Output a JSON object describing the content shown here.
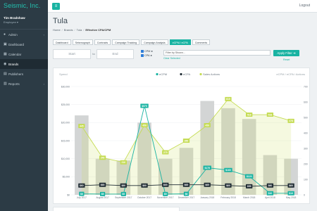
{
  "sidebar": {
    "brand": "Seismic, Inc.",
    "user_name": "Tim Bradshaw",
    "user_role": "Employee",
    "items": [
      {
        "label": "Admin",
        "icon": "user-icon",
        "caret": "‹"
      },
      {
        "label": "Dashboard",
        "icon": "dashboard-icon",
        "caret": ""
      },
      {
        "label": "Calendar",
        "icon": "calendar-icon",
        "caret": ""
      },
      {
        "label": "Brands",
        "icon": "globe-icon",
        "caret": ""
      },
      {
        "label": "Publishers",
        "icon": "folder-icon",
        "caret": ""
      },
      {
        "label": "Reports",
        "icon": "chart-icon",
        "caret": "‹"
      }
    ]
  },
  "topbar": {
    "menu_icon": "hamburger-icon",
    "logout": "Logout"
  },
  "page": {
    "title": "Tula",
    "breadcrumb": [
      "Home",
      "Brands",
      "Tula",
      "Effective CPA/CPM"
    ]
  },
  "tabs": [
    "Dashboard",
    "Seismograph",
    "Contracts",
    "Campaign Tracking",
    "Campaign Analysis",
    "eCPM / eCPA",
    "Comments"
  ],
  "active_tab": 5,
  "filters": {
    "start_placeholder": "Start",
    "to_label": "to",
    "end_placeholder": "End",
    "cpm_label": "CPM",
    "cpa_label": "CPA",
    "show_placeholder": "Filter by Shown...",
    "clear_selected": "Clear Selected",
    "apply_label": "Apply Filter",
    "reset_label": "Reset"
  },
  "colors": {
    "teal": "#19b3a2",
    "ecpa_line": "#1f2b33",
    "sales_line": "#c5dc54",
    "spend_bar": "#d3d5d5"
  },
  "chart_data": {
    "type": "bar",
    "y_left_label": "Spend",
    "y_right_label": "eCPM / eCPA / Actions",
    "legend": [
      "eCPM",
      "eCPA",
      "Sales Actions"
    ],
    "legend_placement": "top-center",
    "categories": [
      "July 2017",
      "August 2017",
      "September 2017",
      "October 2017",
      "November 2017",
      "December 2017",
      "January 2018",
      "February 2018",
      "March 2018",
      "April 2018",
      "May 2018"
    ],
    "ylim_left": [
      0,
      30000
    ],
    "ylim_right": [
      0,
      700
    ],
    "y_ticks_left": [
      "$30,000",
      "$25,000",
      "$20,000",
      "$15,000",
      "$10,000",
      "$5,000",
      "$0"
    ],
    "y_ticks_right": [
      "700",
      "600",
      "500",
      "400",
      "300",
      "200",
      "100",
      "0"
    ],
    "series": [
      {
        "name": "Spend",
        "kind": "bar",
        "values": [
          22000,
          10000,
          9500,
          20000,
          10000,
          13000,
          26000,
          24000,
          21000,
          11000,
          10000
        ]
      },
      {
        "name": "eCPM",
        "kind": "line",
        "values": [
          6,
          5,
          5,
          575,
          5,
          6,
          175,
          160,
          120,
          10,
          10
        ],
        "labels": [
          "$6",
          "$5",
          "$5",
          "$575",
          "$5",
          "$6",
          "$175",
          "$160",
          "$120",
          "$10",
          "$10"
        ]
      },
      {
        "name": "eCPA",
        "kind": "line",
        "values": [
          60,
          65,
          60,
          60,
          65,
          65,
          65,
          60,
          55,
          60,
          60
        ],
        "labels": [
          "$60",
          "$65",
          "$60",
          "$60",
          "$65",
          "$65",
          "$65",
          "$60",
          "$55",
          "$60",
          "$60"
        ]
      },
      {
        "name": "Sales Actions",
        "kind": "line",
        "values": [
          445,
          240,
          210,
          450,
          275,
          350,
          450,
          619,
          518,
          518,
          478
        ],
        "labels": [
          "445",
          "240",
          "210",
          "450",
          "275",
          "350",
          "450",
          "619",
          "518",
          "518",
          "478"
        ]
      }
    ]
  }
}
